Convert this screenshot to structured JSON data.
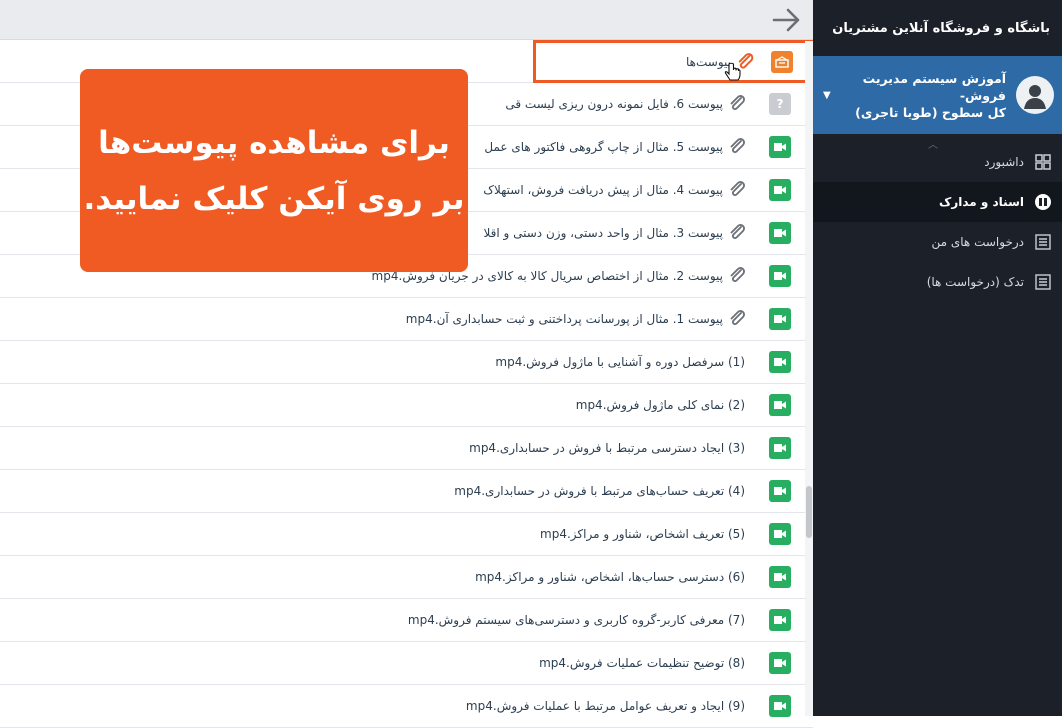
{
  "sidebar": {
    "brand": "باشگاه و فروشگاه آنلاین مشتریان",
    "course": {
      "title_line1": "آموزش سیستم مدیریت فروش-",
      "title_line2": "کل سطوح (طوبا تاجری)"
    },
    "menu": [
      {
        "label": "داشبورد",
        "icon": "dashboard-icon"
      },
      {
        "label": "اسناد و مدارک",
        "icon": "documents-icon",
        "active": true
      },
      {
        "label": "درخواست های من",
        "icon": "list-icon"
      },
      {
        "label": "تدک (درخواست ها)",
        "icon": "list-icon"
      }
    ]
  },
  "main": {
    "header_item": "پیوست‌ها",
    "attachments": [
      {
        "label": "پیوست 6. فایل نمونه درون ریزی لیست قی",
        "type": "unknown"
      },
      {
        "label": "پیوست 5. مثال از چاپ گروهی فاکتور های عمل",
        "type": "video"
      },
      {
        "label": "پیوست 4. مثال از پیش دریافت فروش، استهلاک",
        "type": "video"
      },
      {
        "label": "پیوست 3. مثال از واحد دستی، وزن دستی و اقلا",
        "type": "video"
      },
      {
        "label": "پیوست 2. مثال از اختصاص سریال کالا به کالای در جریان فروش.mp4",
        "type": "video"
      },
      {
        "label": "پیوست 1. مثال از پورسانت پرداختنی و ثبت حسابداری آن.mp4",
        "type": "video"
      }
    ],
    "videos": [
      "(1) سرفصل دوره و آشنایی با ماژول فروش.mp4",
      "(2) نمای کلی ماژول فروش.mp4",
      "(3) ایجاد دسترسی مرتبط با فروش در حسابداری.mp4",
      "(4) تعریف حساب‌های مرتبط با فروش در حسابداری.mp4",
      "(5) تعریف اشخاص، شناور و مراکز.mp4",
      "(6) دسترسی حساب‌ها، اشخاص، شناور و مراکز.mp4",
      "(7) معرفی کاربر-گروه کاربری و دسترسی‌های سیستم فروش.mp4",
      "(8) توضیح تنظیمات عملیات فروش.mp4",
      "(9) ایجاد و تعریف عوامل مرتبط با عملیات فروش.mp4"
    ]
  },
  "callout": {
    "line1": "برای مشاهده پیوست‌ها",
    "line2": "بر روی آیکن کلیک نمایید."
  },
  "colors": {
    "accent": "#f05a23",
    "video": "#27ae60",
    "sidebar": "#1b2029",
    "course": "#2d6aa6"
  }
}
